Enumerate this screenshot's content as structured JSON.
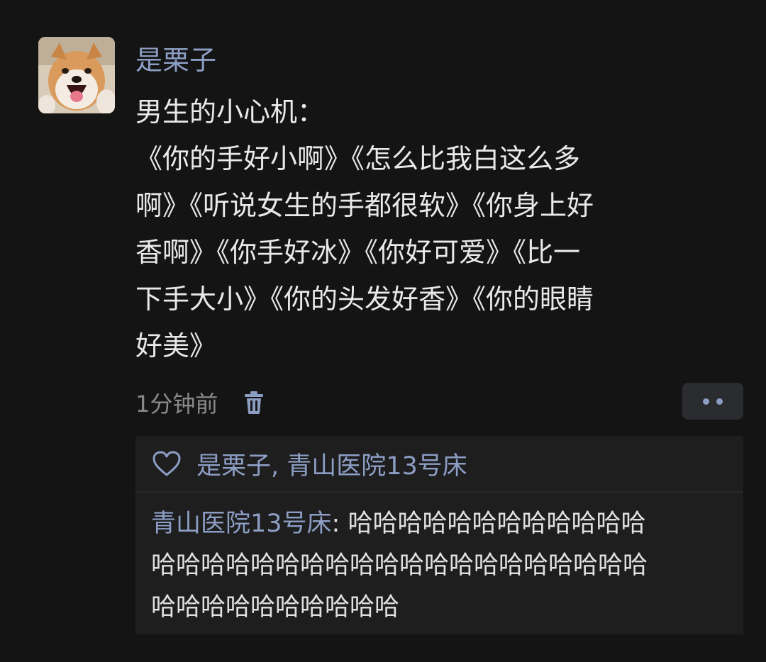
{
  "post": {
    "author": "是栗子",
    "content_lines": [
      "男生的小心机：",
      "《你的手好小啊》《怎么比我白这么多",
      "啊》《听说女生的手都很软》《你身上好",
      "香啊》《你手好冰》《你好可爱》《比一",
      "下手大小》《你的头发好香》《你的眼睛",
      "好美》"
    ],
    "time": "1分钟前",
    "icons": {
      "avatar": "shiba-dog-avatar",
      "delete": "trash-icon",
      "more": "more-dots-icon"
    }
  },
  "interactions": {
    "likers": "是栗子, 青山医院13号床",
    "like_icon": "heart-outline-icon",
    "comment": {
      "author": "青山医院13号床",
      "separator": ": ",
      "text_lines": [
        "哈哈哈哈哈哈哈哈哈哈哈哈",
        "哈哈哈哈哈哈哈哈哈哈哈哈哈哈哈哈哈哈哈哈",
        "哈哈哈哈哈哈哈哈哈哈"
      ]
    }
  },
  "colors": {
    "background": "#141414",
    "name_link": "#8d9ec5",
    "body_text": "#e9e9e9",
    "meta_text": "#8a8a8a",
    "panel": "#1e1e1f"
  }
}
